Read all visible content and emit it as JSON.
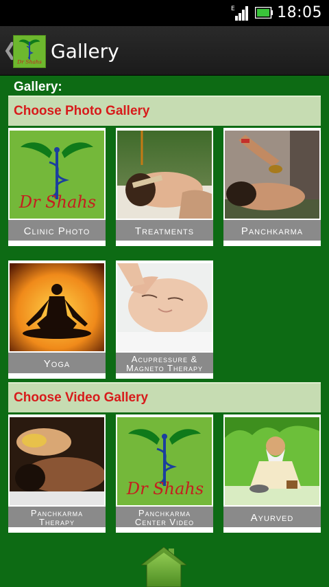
{
  "status_bar": {
    "time": "18:05"
  },
  "action_bar": {
    "back_glyph": "❮",
    "title": "Gallery",
    "logo_text": "Dr Shahs"
  },
  "gallery_label": "Gallery:",
  "photo_section": {
    "title": "Choose Photo Gallery",
    "tiles": [
      {
        "caption": "Clinic Photo",
        "image": "dr-shahs-logo"
      },
      {
        "caption": "Treatments",
        "image": "head-treatment-photo"
      },
      {
        "caption": "Panchkarma",
        "image": "shirodhara-photo"
      },
      {
        "caption": "Yoga",
        "image": "yoga-silhouette-photo"
      },
      {
        "caption_line1": "Acupressure &",
        "caption_line2": "Magneto Therapy",
        "image": "face-massage-photo"
      }
    ]
  },
  "video_section": {
    "title": "Choose Video Gallery",
    "tiles": [
      {
        "caption_line1": "Panchkarma",
        "caption_line2": "Therapy",
        "image": "panchkarma-therapy-photo"
      },
      {
        "caption_line1": "Panchkarma",
        "caption_line2": "Center Video",
        "image": "dr-shahs-logo"
      },
      {
        "caption": "Ayurved",
        "image": "ayurved-sage-illustration"
      }
    ]
  },
  "colors": {
    "background": "#0d6b14",
    "section_bg": "#c6dcb2",
    "section_text": "#d71b1b",
    "caption_bg": "#8a8a8a"
  }
}
